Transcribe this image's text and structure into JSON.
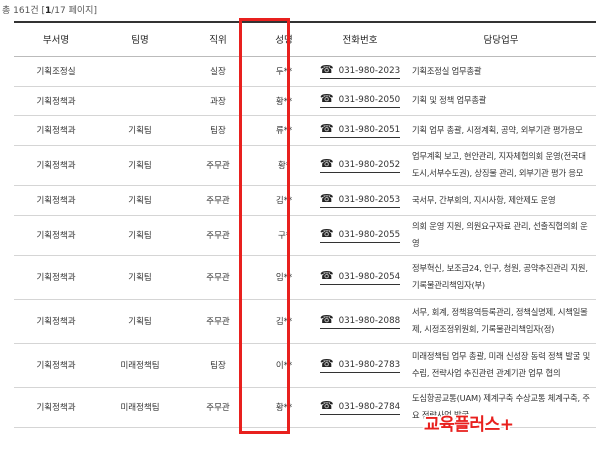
{
  "summary": {
    "total_text": "총 161건",
    "page_open": "[",
    "page_current": "1",
    "page_total": "/17 페이지",
    "page_close": "]"
  },
  "table": {
    "headers": [
      "부서명",
      "팀명",
      "직위",
      "성명",
      "전화번호",
      "담당업무"
    ],
    "rows": [
      {
        "dept": "기획조정실",
        "team": "",
        "position": "실장",
        "name": "두**",
        "phone": "031-980-2023",
        "duty": "기획조정실 업무총괄"
      },
      {
        "dept": "기획정책과",
        "team": "",
        "position": "과장",
        "name": "황**",
        "phone": "031-980-2050",
        "duty": "기획 및 정책 업무총괄"
      },
      {
        "dept": "기획정책과",
        "team": "기획팀",
        "position": "팀장",
        "name": "류**",
        "phone": "031-980-2051",
        "duty": "기획 업무 총괄, 시정계획, 공약, 외부기관 평가응모"
      },
      {
        "dept": "기획정책과",
        "team": "기획팀",
        "position": "주무관",
        "name": "황*",
        "phone": "031-980-2052",
        "duty": "업무계획 보고, 현안관리, 지자체협의회 운영(전국대도시,서부수도권), 상징물 관리, 외부기관 평가 응모"
      },
      {
        "dept": "기획정책과",
        "team": "기획팀",
        "position": "주무관",
        "name": "김**",
        "phone": "031-980-2053",
        "duty": "국서무, 간부회의, 지시사항, 제안제도 운영"
      },
      {
        "dept": "기획정책과",
        "team": "기획팀",
        "position": "주무관",
        "name": "구*",
        "phone": "031-980-2055",
        "duty": "의회 운영 지원, 의원요구자료 관리, 선출직협의회 운영"
      },
      {
        "dept": "기획정책과",
        "team": "기획팀",
        "position": "주무관",
        "name": "임**",
        "phone": "031-980-2054",
        "duty": "정부혁신, 보조금24, 인구, 청원, 공약추진관리 지원, 기록물관리책임자(부)"
      },
      {
        "dept": "기획정책과",
        "team": "기획팀",
        "position": "주무관",
        "name": "김**",
        "phone": "031-980-2088",
        "duty": "서무, 회계, 정책용역등록관리, 정책실명제, 시책일몰제, 시정조정위원회, 기록물관리책임자(정)"
      },
      {
        "dept": "기획정책과",
        "team": "미래정책팀",
        "position": "팀장",
        "name": "이**",
        "phone": "031-980-2783",
        "duty": "미래정책팀 업무 총괄, 미래 신성장 동력 정책 발굴 및 수립, 전략사업 추진관련 관계기관 업무 협의"
      },
      {
        "dept": "기획정책과",
        "team": "미래정책팀",
        "position": "주무관",
        "name": "황**",
        "phone": "031-980-2784",
        "duty": "도심항공교통(UAM) 제계구축 수상교통 체계구축, 주요 전략사업 발굴"
      }
    ]
  },
  "watermark": {
    "text": "교육플러스",
    "plus": "+"
  },
  "colors": {
    "highlight_border": "#e8201e",
    "header_rule": "#333333",
    "row_rule": "#d5d5d5"
  },
  "icons": {
    "phone": "telephone-icon"
  }
}
